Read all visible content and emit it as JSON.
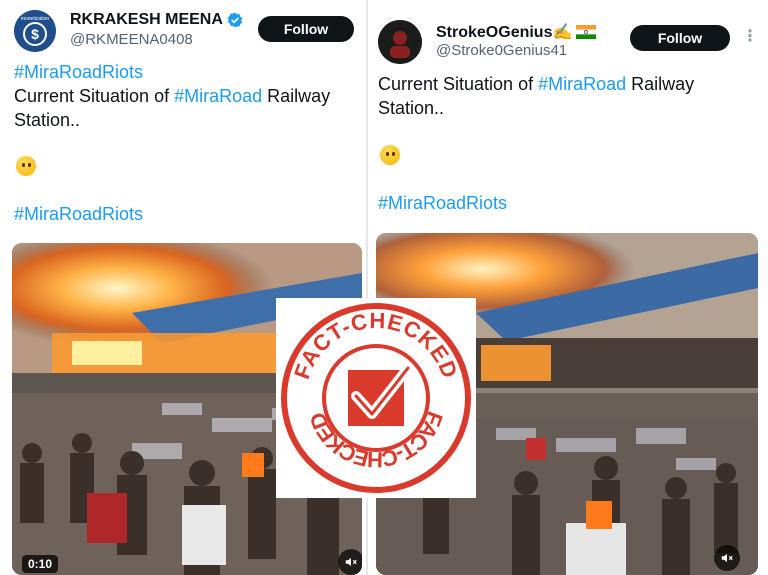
{
  "left_tweet": {
    "display_name": "RKRAKESH MEENA",
    "handle": "@RKMEENA0408",
    "follow_label": "Follow",
    "avatar_text": "monetization",
    "hashtag_top": "#MiraRoadRiots",
    "line1_prefix": "Current Situation of ",
    "line1_hashtag": "#MiraRoad",
    "line1_suffix": " Railway",
    "line2": "Station..",
    "hashtag_bottom": "#MiraRoadRiots",
    "video_time": "0:10"
  },
  "right_tweet": {
    "display_name": "StrokeOGenius✍️",
    "handle": "@Stroke0Genius41",
    "follow_label": "Follow",
    "line1_prefix": "Current Situation of ",
    "line1_hashtag": "#MiraRoad",
    "line1_suffix": " Railway",
    "line2": "Station..",
    "hashtag_bottom": "#MiraRoadRiots"
  },
  "stamp": {
    "top_text": "FACT-CHECKED",
    "bottom_text": "FACT-CHECKED",
    "color": "#d93a2b"
  },
  "colors": {
    "hashtag": "#1d9bf0",
    "verified": "#1d9bf0",
    "follow_bg": "#0f1419"
  }
}
